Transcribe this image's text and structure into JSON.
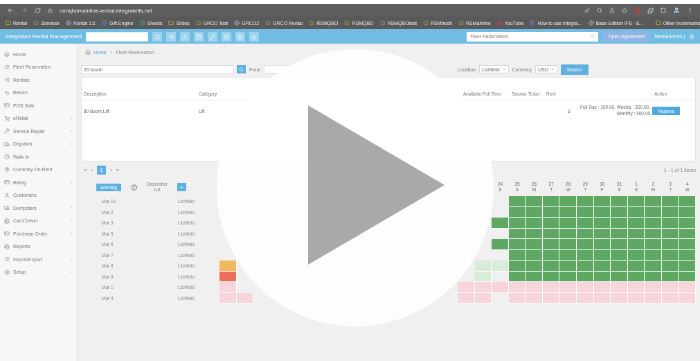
{
  "browser": {
    "url": "rsmqbomainline-rental.integrateifs.net",
    "bookmarks": [
      "Rental",
      "Zendesk",
      "Rental 1:1",
      "Gift Engine",
      "Sheets",
      "Slides",
      "GRCO Test",
      "GRCO2",
      "GRCO Rental",
      "RSMQBO",
      "RSMQBO",
      "RSMQBOtest",
      "RSMtresh",
      "RSMainline",
      "YouTube",
      "How to use integra...",
      "Base Edition IFS - 8..."
    ],
    "other_bookmarks": "Other bookmarks"
  },
  "header": {
    "brand": "Integrated Rental Management",
    "reservation_placeholder": "Fleet Reservation",
    "open_button": "Open Agreement",
    "user": "RentalAdmin |"
  },
  "sidebar": {
    "items": [
      {
        "label": "Home",
        "expandable": false
      },
      {
        "label": "Fleet Reservation",
        "expandable": false
      },
      {
        "label": "Rentals",
        "expandable": false
      },
      {
        "label": "Return",
        "expandable": false
      },
      {
        "label": "POS Sale",
        "expandable": false
      },
      {
        "label": "eRetail",
        "expandable": true
      },
      {
        "label": "Service Repair",
        "expandable": true
      },
      {
        "label": "Dispatch",
        "expandable": true
      },
      {
        "label": "Walk In",
        "expandable": false
      },
      {
        "label": "Currently On Rent",
        "expandable": false
      },
      {
        "label": "Billing",
        "expandable": true
      },
      {
        "label": "Customers",
        "expandable": false
      },
      {
        "label": "Dumpsters",
        "expandable": true
      },
      {
        "label": "Card Driver",
        "expandable": true
      },
      {
        "label": "Purchase Order",
        "expandable": true
      },
      {
        "label": "Reports",
        "expandable": false
      },
      {
        "label": "Import/Export",
        "expandable": true
      },
      {
        "label": "Setup",
        "expandable": true
      }
    ]
  },
  "breadcrumb": [
    "Home",
    "Fleet Reservation"
  ],
  "filters": {
    "search": "20 boom",
    "from_label": "From",
    "location_label": "Location",
    "location": "Lichfield",
    "currency_label": "Currency",
    "currency": "USD",
    "search_button": "Search"
  },
  "table": {
    "columns": [
      {
        "label": "Description"
      },
      {
        "label": "Category"
      },
      null,
      null,
      null,
      null,
      null,
      null,
      {
        "label": "Available Full Term"
      },
      {
        "label": "Service Ticket"
      },
      {
        "label": "Rent"
      },
      null,
      {
        "label": "Action"
      }
    ],
    "rows": [
      {
        "cells": [
          "80 Boom Lift",
          "Lift",
          null,
          null,
          null,
          null,
          null,
          null,
          null,
          null,
          "3"
        ],
        "rates": [
          "Full Day : 100.00, Weekly : 300.00,",
          "Monthly : 900.00"
        ],
        "action": "Reserve"
      }
    ]
  },
  "pagination": {
    "first": "«",
    "previous": "‹",
    "pages": [
      {
        "label": "1",
        "selected": true
      }
    ],
    "next": "›",
    "last": "»",
    "summary": "1 - 1 of 1 items"
  },
  "calendar": {
    "warning_button": "Warning",
    "month": "December",
    "lot": "Lot",
    "days": [
      {
        "d": "24",
        "w": "S"
      },
      {
        "d": "25",
        "w": "S"
      },
      {
        "d": "26",
        "w": "M"
      },
      {
        "d": "27",
        "w": "T"
      },
      {
        "d": "28",
        "w": "W"
      },
      {
        "d": "29",
        "w": "T"
      },
      {
        "d": "30",
        "w": "F"
      },
      {
        "d": "31",
        "w": "S"
      },
      {
        "d": "1",
        "w": "S"
      },
      {
        "d": "2",
        "w": "M"
      },
      {
        "d": "3",
        "w": "T"
      },
      {
        "d": "4",
        "w": "W"
      }
    ],
    "rows": [
      {
        "unit": "Mar 19",
        "location": "Lichfield",
        "cells": [
          null,
          null,
          null,
          null,
          null,
          null,
          null,
          null,
          null,
          null,
          null,
          null,
          null,
          null,
          null,
          null,
          null,
          {
            "color": "#5ea863"
          },
          {
            "color": "#5ea863"
          },
          {
            "color": "#5ea863"
          },
          {
            "color": "#5ea863"
          },
          {
            "color": "#5ea863"
          },
          {
            "color": "#5ea863"
          },
          {
            "color": "#5ea863"
          },
          {
            "color": "#5ea863"
          },
          {
            "color": "#5ea863"
          },
          {
            "color": "#5ea863"
          },
          {
            "color": "#5ea863"
          }
        ]
      },
      {
        "unit": "Mar 2",
        "location": "Lichfield",
        "cells": [
          null,
          null,
          null,
          null,
          null,
          null,
          null,
          null,
          null,
          null,
          null,
          null,
          null,
          null,
          null,
          null,
          null,
          {
            "color": "#5ea863"
          },
          {
            "color": "#5ea863"
          },
          {
            "color": "#5ea863"
          },
          {
            "color": "#5ea863"
          },
          {
            "color": "#5ea863"
          },
          {
            "color": "#5ea863"
          },
          {
            "color": "#5ea863"
          },
          {
            "color": "#5ea863"
          },
          {
            "color": "#5ea863"
          },
          {
            "color": "#5ea863"
          },
          {
            "color": "#5ea863"
          }
        ]
      },
      {
        "unit": "Mar 3",
        "location": "Lichfield",
        "cells": [
          null,
          null,
          null,
          null,
          null,
          null,
          null,
          null,
          null,
          null,
          null,
          null,
          null,
          null,
          null,
          null,
          {
            "color": "#5ea863"
          },
          {
            "color": "#5ea863"
          },
          {
            "color": "#5ea863"
          },
          {
            "color": "#5ea863"
          },
          {
            "color": "#5ea863"
          },
          {
            "color": "#5ea863"
          },
          {
            "color": "#5ea863"
          },
          {
            "color": "#5ea863"
          },
          {
            "color": "#5ea863"
          },
          {
            "color": "#5ea863"
          },
          {
            "color": "#5ea863"
          },
          {
            "color": "#5ea863"
          }
        ]
      },
      {
        "unit": "Mar 5",
        "location": "Lichfield",
        "cells": [
          null,
          null,
          null,
          null,
          null,
          null,
          null,
          null,
          null,
          null,
          null,
          null,
          null,
          null,
          null,
          null,
          null,
          {
            "color": "#5ea863"
          },
          {
            "color": "#5ea863"
          },
          {
            "color": "#5ea863"
          },
          {
            "color": "#5ea863"
          },
          {
            "color": "#5ea863"
          },
          {
            "color": "#5ea863"
          },
          {
            "color": "#5ea863"
          },
          {
            "color": "#5ea863"
          },
          {
            "color": "#5ea863"
          },
          {
            "color": "#5ea863"
          },
          {
            "color": "#5ea863"
          }
        ]
      },
      {
        "unit": "Mar 6",
        "location": "Lichfield",
        "cells": [
          null,
          null,
          null,
          null,
          null,
          null,
          null,
          null,
          null,
          null,
          null,
          null,
          null,
          null,
          null,
          null,
          {
            "color": "#5ea863"
          },
          {
            "color": "#5ea863"
          },
          {
            "color": "#5ea863"
          },
          {
            "color": "#5ea863"
          },
          {
            "color": "#5ea863"
          },
          {
            "color": "#5ea863"
          },
          {
            "color": "#5ea863"
          },
          {
            "color": "#5ea863"
          },
          {
            "color": "#5ea863"
          },
          {
            "color": "#5ea863"
          },
          {
            "color": "#5ea863"
          },
          {
            "color": "#5ea863"
          }
        ]
      },
      {
        "unit": "Mar 7",
        "location": "Lichfield",
        "cells": [
          null,
          null,
          null,
          null,
          null,
          null,
          null,
          null,
          null,
          null,
          null,
          null,
          null,
          null,
          null,
          null,
          null,
          {
            "color": "#5ea863"
          },
          {
            "color": "#5ea863"
          },
          {
            "color": "#5ea863"
          },
          {
            "color": "#5ea863"
          },
          {
            "color": "#5ea863"
          },
          {
            "color": "#5ea863"
          },
          {
            "color": "#5ea863"
          },
          {
            "color": "#5ea863"
          },
          {
            "color": "#5ea863"
          },
          {
            "color": "#5ea863"
          },
          {
            "color": "#5ea863"
          }
        ]
      },
      {
        "unit": "Mar 8",
        "location": "Lichfield",
        "cells": [
          {
            "color": "#f1b85c"
          },
          null,
          null,
          null,
          null,
          null,
          null,
          null,
          null,
          null,
          null,
          null,
          null,
          null,
          null,
          {
            "color": "#d8ecd9"
          },
          {
            "color": "#d8ecd9"
          },
          {
            "color": "#5ea863"
          },
          {
            "color": "#5ea863"
          },
          {
            "color": "#5ea863"
          },
          {
            "color": "#5ea863"
          },
          {
            "color": "#5ea863"
          },
          {
            "color": "#5ea863"
          },
          {
            "color": "#5ea863"
          },
          {
            "color": "#5ea863"
          },
          {
            "color": "#5ea863"
          },
          {
            "color": "#5ea863"
          },
          {
            "color": "#5ea863"
          }
        ]
      },
      {
        "unit": "Mar 9",
        "location": "Lichfield",
        "cells": [
          {
            "color": "#ec6d5d"
          },
          null,
          null,
          null,
          null,
          null,
          null,
          null,
          null,
          null,
          null,
          null,
          null,
          null,
          null,
          {
            "color": "#d8ecd9"
          },
          null,
          {
            "color": "#5ea863"
          },
          {
            "color": "#5ea863"
          },
          {
            "color": "#5ea863"
          },
          {
            "color": "#5ea863"
          },
          {
            "color": "#5ea863"
          },
          {
            "color": "#5ea863"
          },
          {
            "color": "#5ea863"
          },
          {
            "color": "#5ea863"
          },
          {
            "color": "#5ea863"
          },
          {
            "color": "#5ea863"
          },
          {
            "color": "#5ea863"
          }
        ]
      },
      {
        "unit": "Mar 1",
        "location": "Lichfield",
        "cells": [
          {
            "color": "#f7d5da"
          },
          null,
          null,
          null,
          null,
          null,
          null,
          null,
          null,
          null,
          null,
          null,
          null,
          null,
          {
            "color": "#f7d5da"
          },
          {
            "color": "#f7d5da"
          },
          {
            "color": "#f7d5da"
          },
          {
            "color": "#f7d5da"
          },
          {
            "color": "#f7d5da"
          },
          {
            "color": "#f7d5da"
          },
          {
            "color": "#f7d5da"
          },
          {
            "color": "#f7d5da"
          },
          {
            "color": "#f7d5da"
          },
          {
            "color": "#f7d5da"
          },
          {
            "color": "#f7d5da"
          },
          {
            "color": "#f7d5da"
          },
          {
            "color": "#f7d5da"
          },
          {
            "color": "#f7d5da"
          }
        ]
      },
      {
        "unit": "Mar 4",
        "location": "Lichfield",
        "cells": [
          {
            "color": "#f7d5da"
          },
          {
            "color": "#f7d5da"
          },
          null,
          null,
          null,
          null,
          null,
          null,
          null,
          null,
          null,
          null,
          null,
          null,
          {
            "color": "#f7d5da"
          },
          {
            "color": "#f7d5da"
          },
          null,
          {
            "color": "#f7d5da"
          },
          {
            "color": "#f7d5da"
          },
          {
            "color": "#f7d5da"
          },
          {
            "color": "#f7d5da"
          },
          {
            "color": "#f7d5da"
          },
          {
            "color": "#f7d5da"
          },
          {
            "color": "#f7d5da"
          },
          {
            "color": "#f7d5da"
          },
          {
            "color": "#f7d5da"
          },
          {
            "color": "#f7d5da"
          },
          {
            "color": "#f7d5da"
          }
        ]
      }
    ]
  }
}
